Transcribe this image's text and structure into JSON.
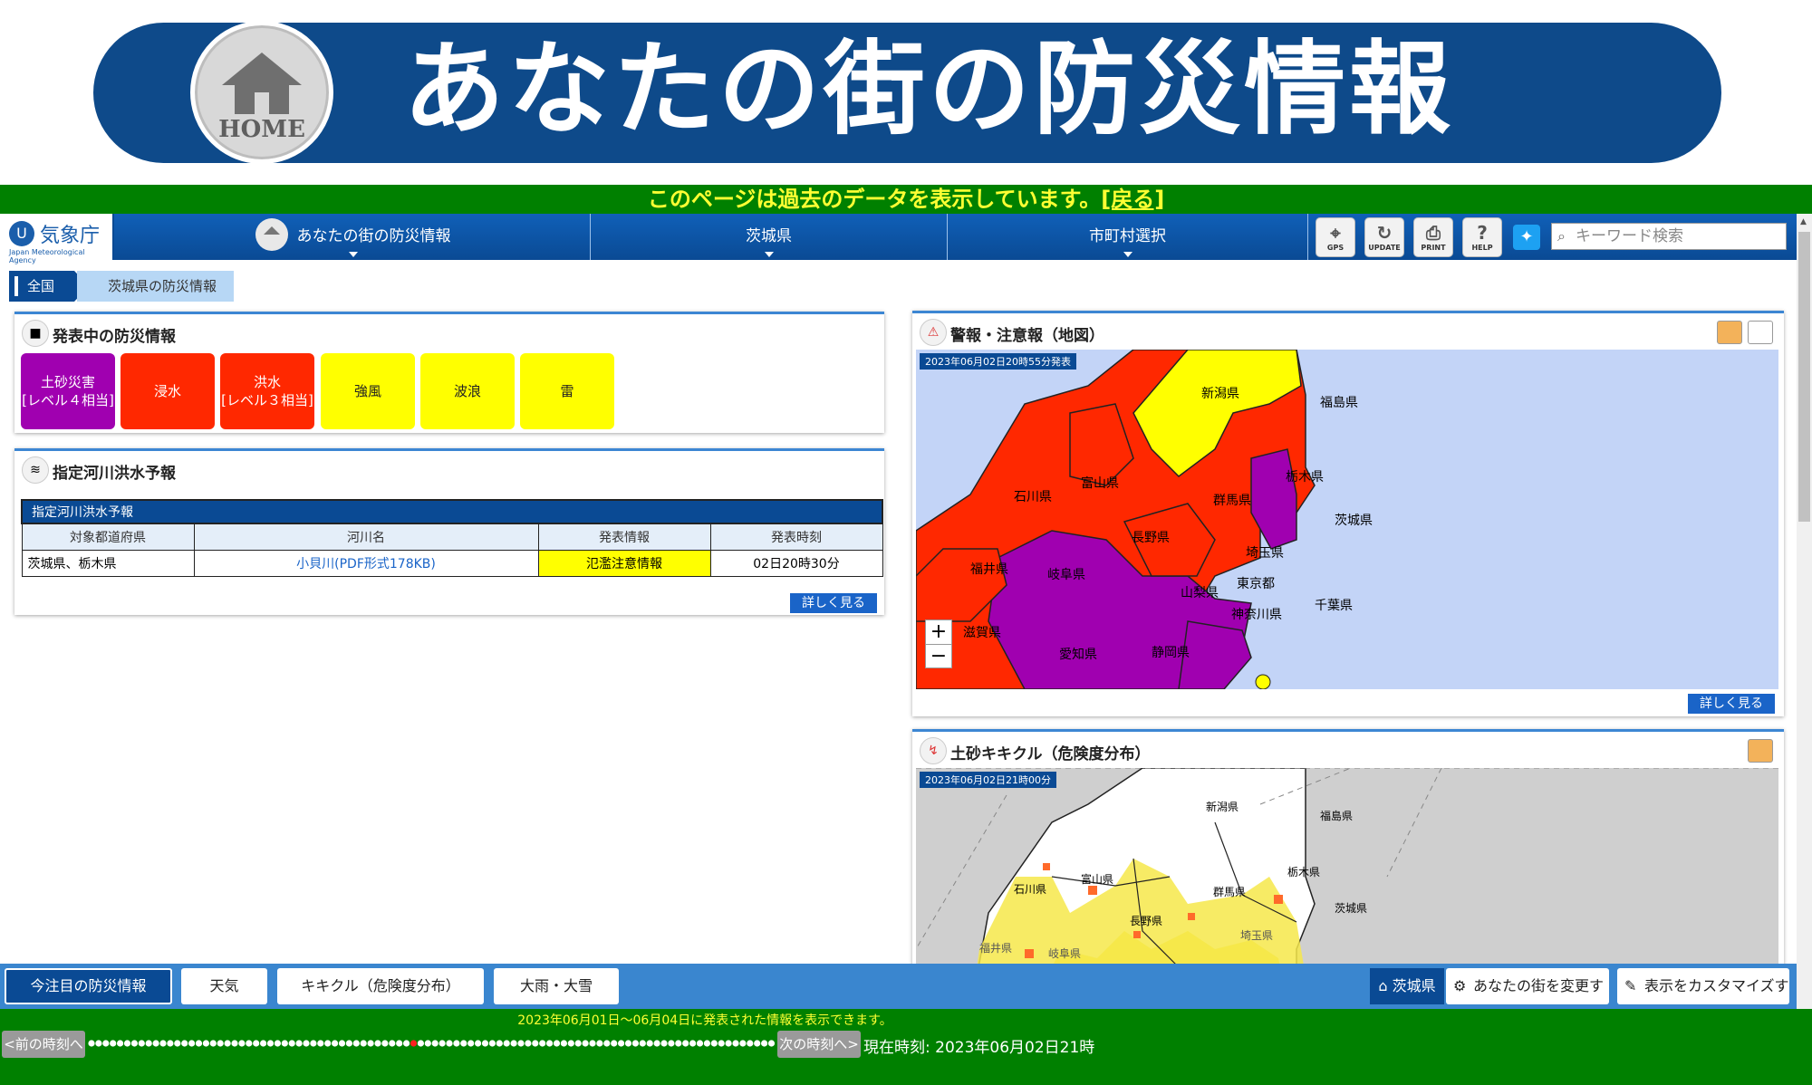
{
  "banner": {
    "title": "あなたの街の防災情報",
    "home_label": "HOME"
  },
  "notice": {
    "text": "このページは過去のデータを表示しています。",
    "link": "[戻る]"
  },
  "nav": {
    "logo_name": "気象庁",
    "logo_sub": "Japan Meteorological Agency",
    "items": [
      "あなたの街の防災情報",
      "茨城県",
      "市町村選択"
    ],
    "tools": [
      "GPS",
      "UPDATE",
      "PRINT",
      "HELP"
    ],
    "search_placeholder": "キーワード検索"
  },
  "breadcrumb": [
    "全国",
    "茨城県の防災情報"
  ],
  "warnings_panel": {
    "title": "発表中の防災情報",
    "tiles": [
      {
        "line1": "土砂災害",
        "line2": "[レベル４相当]",
        "color": "#a000b0"
      },
      {
        "line1": "浸水",
        "line2": "",
        "color": "#ff2800"
      },
      {
        "line1": "洪水",
        "line2": "[レベル３相当]",
        "color": "#ff2800"
      },
      {
        "line1": "強風",
        "line2": "",
        "color": "#ffff00"
      },
      {
        "line1": "波浪",
        "line2": "",
        "color": "#ffff00"
      },
      {
        "line1": "雷",
        "line2": "",
        "color": "#ffff00"
      }
    ]
  },
  "river_panel": {
    "title": "指定河川洪水予報",
    "table_caption": "指定河川洪水予報",
    "headers": [
      "対象都道府県",
      "河川名",
      "発表情報",
      "発表時刻"
    ],
    "rows": [
      [
        "茨城県、栃木県",
        "小貝川(PDF形式178KB)",
        "氾濫注意情報",
        "02日20時30分"
      ]
    ],
    "more": "詳しく見る"
  },
  "map_panel": {
    "title": "警報・注意報（地図）",
    "timestamp": "2023年06月02日20時55分発表",
    "more": "詳しく見る",
    "zoom_in": "+",
    "zoom_out": "−",
    "prefectures": [
      "新潟県",
      "福島県",
      "富山県",
      "石川県",
      "栃木県",
      "群馬県",
      "茨城県",
      "長野県",
      "埼玉県",
      "福井県",
      "岐阜県",
      "東京都",
      "山梨県",
      "神奈川県",
      "千葉県",
      "滋賀県",
      "愛知県",
      "静岡県"
    ]
  },
  "kikikuru_panel": {
    "title": "土砂キキクル（危険度分布）",
    "timestamp": "2023年06月02日21時00分",
    "prefectures": [
      "新潟県",
      "福島県",
      "富山県",
      "栃木県",
      "石川県",
      "群馬県",
      "茨城県",
      "長野県",
      "福井県",
      "岐阜県",
      "埼玉県"
    ]
  },
  "bottom_bar": {
    "buttons": [
      "今注目の防災情報",
      "天気",
      "キキクル（危険度分布）",
      "大雨・大雪"
    ],
    "pref": "茨城県",
    "change": "あなたの街を変更する",
    "customize": "表示をカスタマイズする"
  },
  "timeline": {
    "note": "2023年06月01日～06月04日に発表された情報を表示できます。",
    "prev": "<前の時刻へ",
    "next": "次の時刻へ>",
    "current_label": "現在時刻: ",
    "current": "2023年06月02日21時"
  }
}
